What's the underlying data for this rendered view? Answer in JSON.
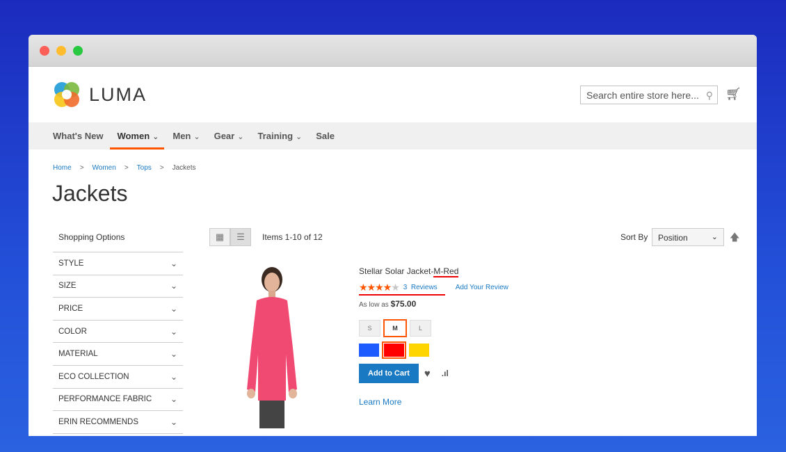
{
  "window": {
    "controls": [
      {
        "name": "close",
        "color": "#fe5f57"
      },
      {
        "name": "minimize",
        "color": "#febc2e"
      },
      {
        "name": "maximize",
        "color": "#28c840"
      }
    ]
  },
  "header": {
    "logo_text": "LUMA",
    "search_placeholder": "Search entire store here...",
    "cart_icon": "cart-icon"
  },
  "nav": {
    "items": [
      {
        "label": "What's New",
        "dropdown": false
      },
      {
        "label": "Women",
        "dropdown": true,
        "active": true
      },
      {
        "label": "Men",
        "dropdown": true
      },
      {
        "label": "Gear",
        "dropdown": true
      },
      {
        "label": "Training",
        "dropdown": true
      },
      {
        "label": "Sale",
        "dropdown": false
      }
    ]
  },
  "breadcrumb": [
    "Home",
    "Women",
    "Tops",
    "Jackets"
  ],
  "page_title": "Jackets",
  "sidebar": {
    "title": "Shopping Options",
    "filters": [
      "STYLE",
      "SIZE",
      "PRICE",
      "COLOR",
      "MATERIAL",
      "ECO COLLECTION",
      "PERFORMANCE FABRIC",
      "ERIN RECOMMENDS"
    ]
  },
  "toolbar": {
    "view_modes": [
      "grid",
      "list"
    ],
    "active_view": "list",
    "amount": "Items 1-10 of 12",
    "sort_label": "Sort By",
    "sort_value": "Position"
  },
  "product": {
    "name_prefix": "Stellar Solar Jacket-",
    "name_suffix": "M-Red",
    "rating_percent": 90,
    "reviews_count": "3",
    "reviews_label": "Reviews",
    "add_review": "Add Your Review",
    "price_label": "As low as",
    "price": "$75.00",
    "sizes": [
      "S",
      "M",
      "L"
    ],
    "selected_size": "M",
    "colors": [
      "#1e5bff",
      "#ff0000",
      "#ffd500"
    ],
    "selected_color": "#ff0000",
    "add_to_cart": "Add to Cart",
    "learn_more": "Learn More"
  },
  "colors": {
    "accent": "#ff5501",
    "link": "#1979c3",
    "annotation": "#e00000"
  }
}
